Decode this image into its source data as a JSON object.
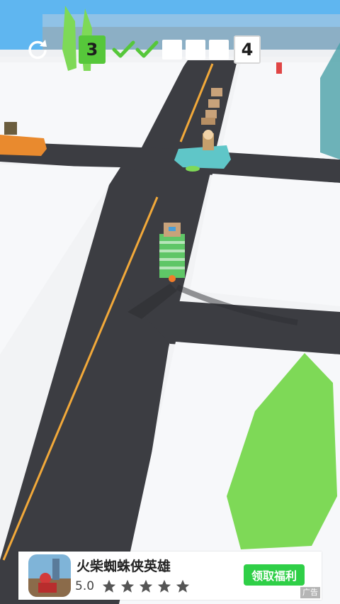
{
  "hud": {
    "current_level": "3",
    "next_level": "4",
    "steps": [
      {
        "state": "done"
      },
      {
        "state": "done"
      },
      {
        "state": "todo"
      },
      {
        "state": "todo"
      },
      {
        "state": "todo"
      }
    ],
    "icons": {
      "restart": "restart-icon",
      "check": "check-icon"
    }
  },
  "ad": {
    "title": "火柴蜘蛛侠英雄",
    "rating": "5.0",
    "stars": 5,
    "cta": "领取福利",
    "label": "广告"
  },
  "colors": {
    "road": "#3c3d42",
    "lane_yellow": "#f2a93a",
    "sidewalk": "#f4f5f7",
    "grass_tree": "#7ed957",
    "accent_green": "#56c73a",
    "cta_green": "#2fcf47",
    "car_teal": "#5fc6c8",
    "car_orange": "#e98a2e"
  }
}
